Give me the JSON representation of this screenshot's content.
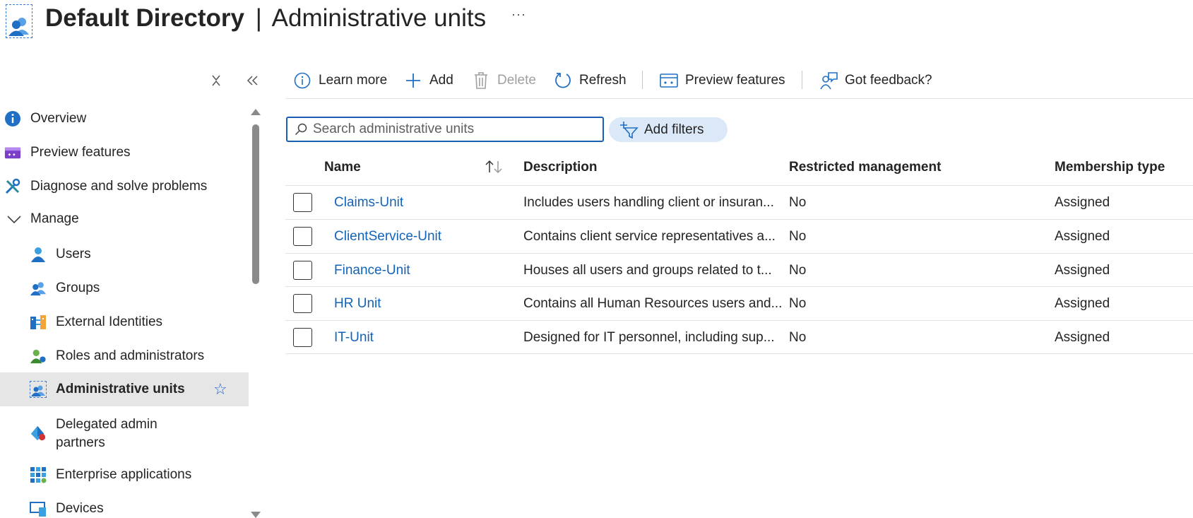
{
  "header": {
    "title_bold": "Default Directory",
    "separator": "|",
    "title_rest": "Administrative units",
    "more_label": "···"
  },
  "sidebar": {
    "items": [
      {
        "label": "Overview",
        "icon": "info-icon"
      },
      {
        "label": "Preview features",
        "icon": "preview-icon"
      },
      {
        "label": "Diagnose and solve problems",
        "icon": "wrench-icon"
      },
      {
        "label": "Manage",
        "icon": "chevron-down-icon"
      },
      {
        "label": "Users",
        "icon": "user-icon"
      },
      {
        "label": "Groups",
        "icon": "group-icon"
      },
      {
        "label": "External Identities",
        "icon": "external-identities-icon"
      },
      {
        "label": "Roles and administrators",
        "icon": "roles-icon"
      },
      {
        "label": "Administrative units",
        "icon": "admin-units-icon",
        "active": true
      },
      {
        "label": "Delegated admin",
        "label2": "partners",
        "icon": "delegated-admin-icon"
      },
      {
        "label": "Enterprise applications",
        "icon": "enterprise-apps-icon"
      },
      {
        "label": "Devices",
        "icon": "devices-icon"
      }
    ]
  },
  "toolbar": {
    "learn_more": "Learn more",
    "add": "Add",
    "delete": "Delete",
    "refresh": "Refresh",
    "preview_features": "Preview features",
    "feedback": "Got feedback?"
  },
  "search": {
    "placeholder": "Search administrative units",
    "value": ""
  },
  "filters": {
    "label": "Add filters"
  },
  "table": {
    "columns": [
      "Name",
      "Description",
      "Restricted management",
      "Membership type"
    ],
    "rows": [
      {
        "name": "Claims-Unit",
        "description": "Includes users handling client or insuran...",
        "restricted": "No",
        "membership": "Assigned"
      },
      {
        "name": "ClientService-Unit",
        "description": "Contains client service representatives a...",
        "restricted": "No",
        "membership": "Assigned"
      },
      {
        "name": "Finance-Unit",
        "description": "Houses all users and groups related to t...",
        "restricted": "No",
        "membership": "Assigned"
      },
      {
        "name": "HR Unit",
        "description": "Contains all Human Resources users and...",
        "restricted": "No",
        "membership": "Assigned"
      },
      {
        "name": "IT-Unit",
        "description": "Designed for IT personnel, including sup...",
        "restricted": "No",
        "membership": "Assigned"
      }
    ]
  },
  "colors": {
    "accent": "#1264b8",
    "active_bg": "#e6e6e6",
    "filter_bg": "#dbe8f7"
  }
}
